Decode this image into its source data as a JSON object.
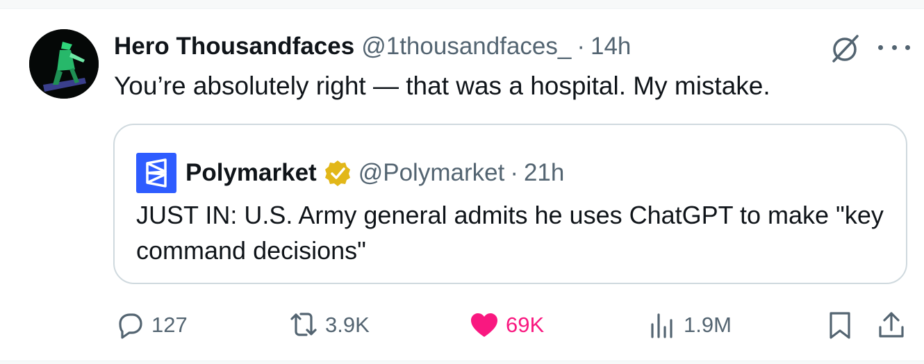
{
  "tweet": {
    "author_name": "Hero Thousandfaces",
    "author_handle": "@1thousandfaces_",
    "separator": "·",
    "time": "14h",
    "text": "You’re absolutely right — that was a hospital. My mistake."
  },
  "quoted_tweet": {
    "author_name": "Polymarket",
    "author_handle": "@Polymarket",
    "separator": "·",
    "time": "21h",
    "text": "JUST IN: U.S. Army general admits he uses ChatGPT to make \"key command decisions\"",
    "verified_badge_color": "#e2b719",
    "avatar_color": "#2e5cff"
  },
  "actions": {
    "replies": "127",
    "reposts": "3.9K",
    "likes": "69K",
    "views": "1.9M"
  },
  "icons": {
    "reply": "reply-icon",
    "repost": "repost-icon",
    "like": "heart-icon",
    "views": "views-icon",
    "bookmark": "bookmark-icon",
    "share": "share-icon",
    "grok": "grok-icon",
    "more": "more-icon"
  },
  "colors": {
    "text": "#0f1419",
    "secondary": "#536471",
    "like": "#f91880",
    "border": "#cfd9de"
  }
}
